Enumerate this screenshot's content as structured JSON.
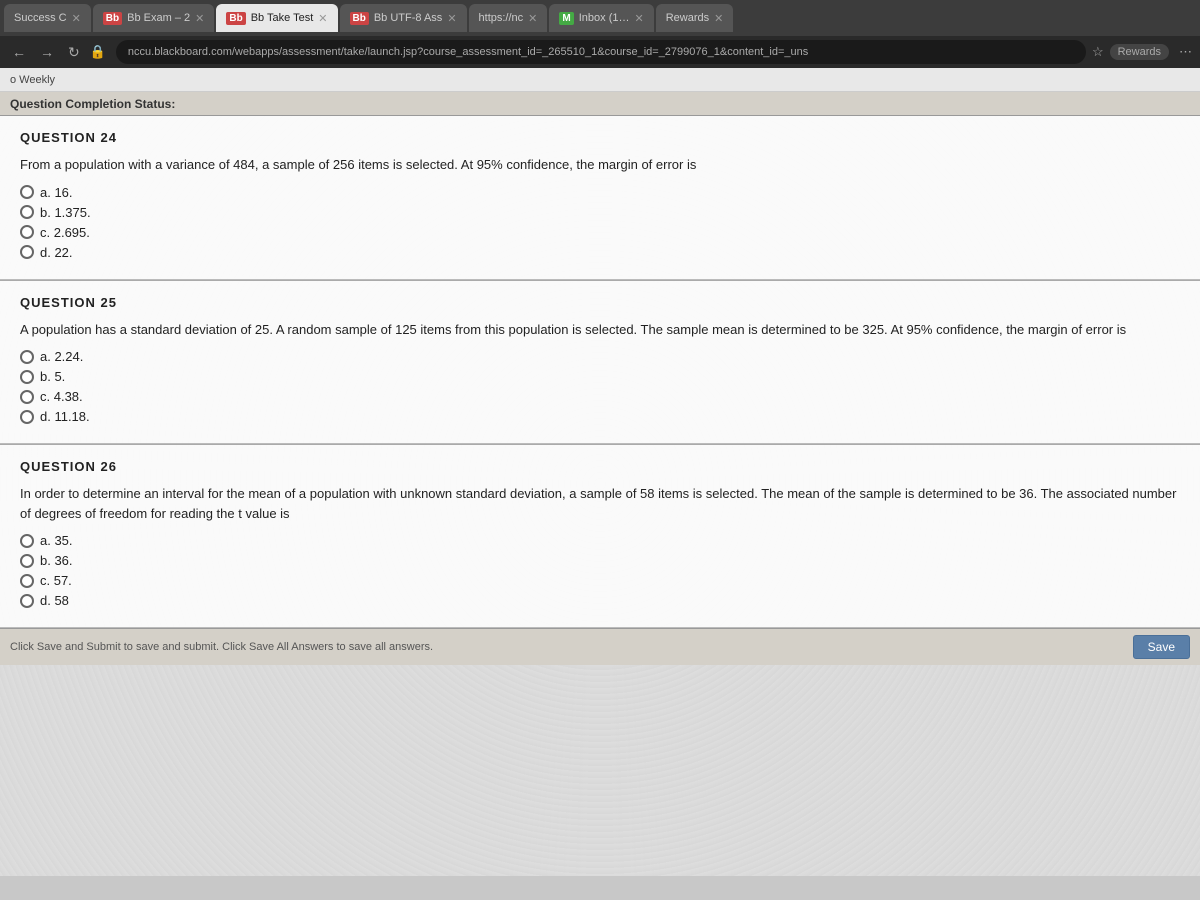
{
  "browser": {
    "tabs": [
      {
        "id": "tab1",
        "label": "Success C",
        "icon": "",
        "active": false,
        "type": "generic"
      },
      {
        "id": "tab2",
        "label": "Bb Exam – 2",
        "icon": "Bb",
        "active": false,
        "type": "bb"
      },
      {
        "id": "tab3",
        "label": "Bb Take Test",
        "icon": "Bb",
        "active": true,
        "type": "bb"
      },
      {
        "id": "tab4",
        "label": "Bb UTF-8 Ass",
        "icon": "Bb",
        "active": false,
        "type": "bb"
      },
      {
        "id": "tab5",
        "label": "https://nc",
        "icon": "",
        "active": false,
        "type": "generic"
      },
      {
        "id": "tab6",
        "label": "Inbox (1…",
        "icon": "M",
        "active": false,
        "type": "mail"
      },
      {
        "id": "tab7",
        "label": "Rewards",
        "icon": "",
        "active": false,
        "type": "generic"
      }
    ],
    "address": "nccu.blackboard.com/webapps/assessment/take/launch.jsp?course_assessment_id=_265510_1&course_id=_2799076_1&content_id=_uns",
    "secondary_bar_label": "o Weekly"
  },
  "page": {
    "completion_status_label": "Question Completion Status:",
    "questions": [
      {
        "id": "q24",
        "title": "QUESTION 24",
        "text": "From a population with a variance of 484, a sample of 256 items is selected. At 95% confidence, the margin of error is",
        "options": [
          {
            "label": "a. 16.",
            "selected": false
          },
          {
            "label": "b. 1.375.",
            "selected": false
          },
          {
            "label": "c. 2.695.",
            "selected": false
          },
          {
            "label": "d. 22.",
            "selected": false
          }
        ]
      },
      {
        "id": "q25",
        "title": "QUESTION 25",
        "text": "A population has a standard deviation of 25. A random sample of 125 items from this population is selected. The sample mean is determined to be 325. At 95% confidence, the margin of error is",
        "options": [
          {
            "label": "a. 2.24.",
            "selected": false
          },
          {
            "label": "b. 5.",
            "selected": false
          },
          {
            "label": "c. 4.38.",
            "selected": false
          },
          {
            "label": "d. 11.18.",
            "selected": false
          }
        ]
      },
      {
        "id": "q26",
        "title": "QUESTION 26",
        "text": "In order to determine an interval for the mean of a population with unknown standard deviation, a sample of 58 items is selected. The mean of the sample is determined to be 36. The associated number of degrees of freedom for reading the t value is",
        "options": [
          {
            "label": "a. 35.",
            "selected": false
          },
          {
            "label": "b. 36.",
            "selected": false
          },
          {
            "label": "c. 57.",
            "selected": false
          },
          {
            "label": "d. 58",
            "selected": false
          }
        ]
      }
    ],
    "footer": {
      "instruction": "Click Save and Submit to save and submit. Click Save All Answers to save all answers.",
      "save_button_label": "Save"
    }
  }
}
